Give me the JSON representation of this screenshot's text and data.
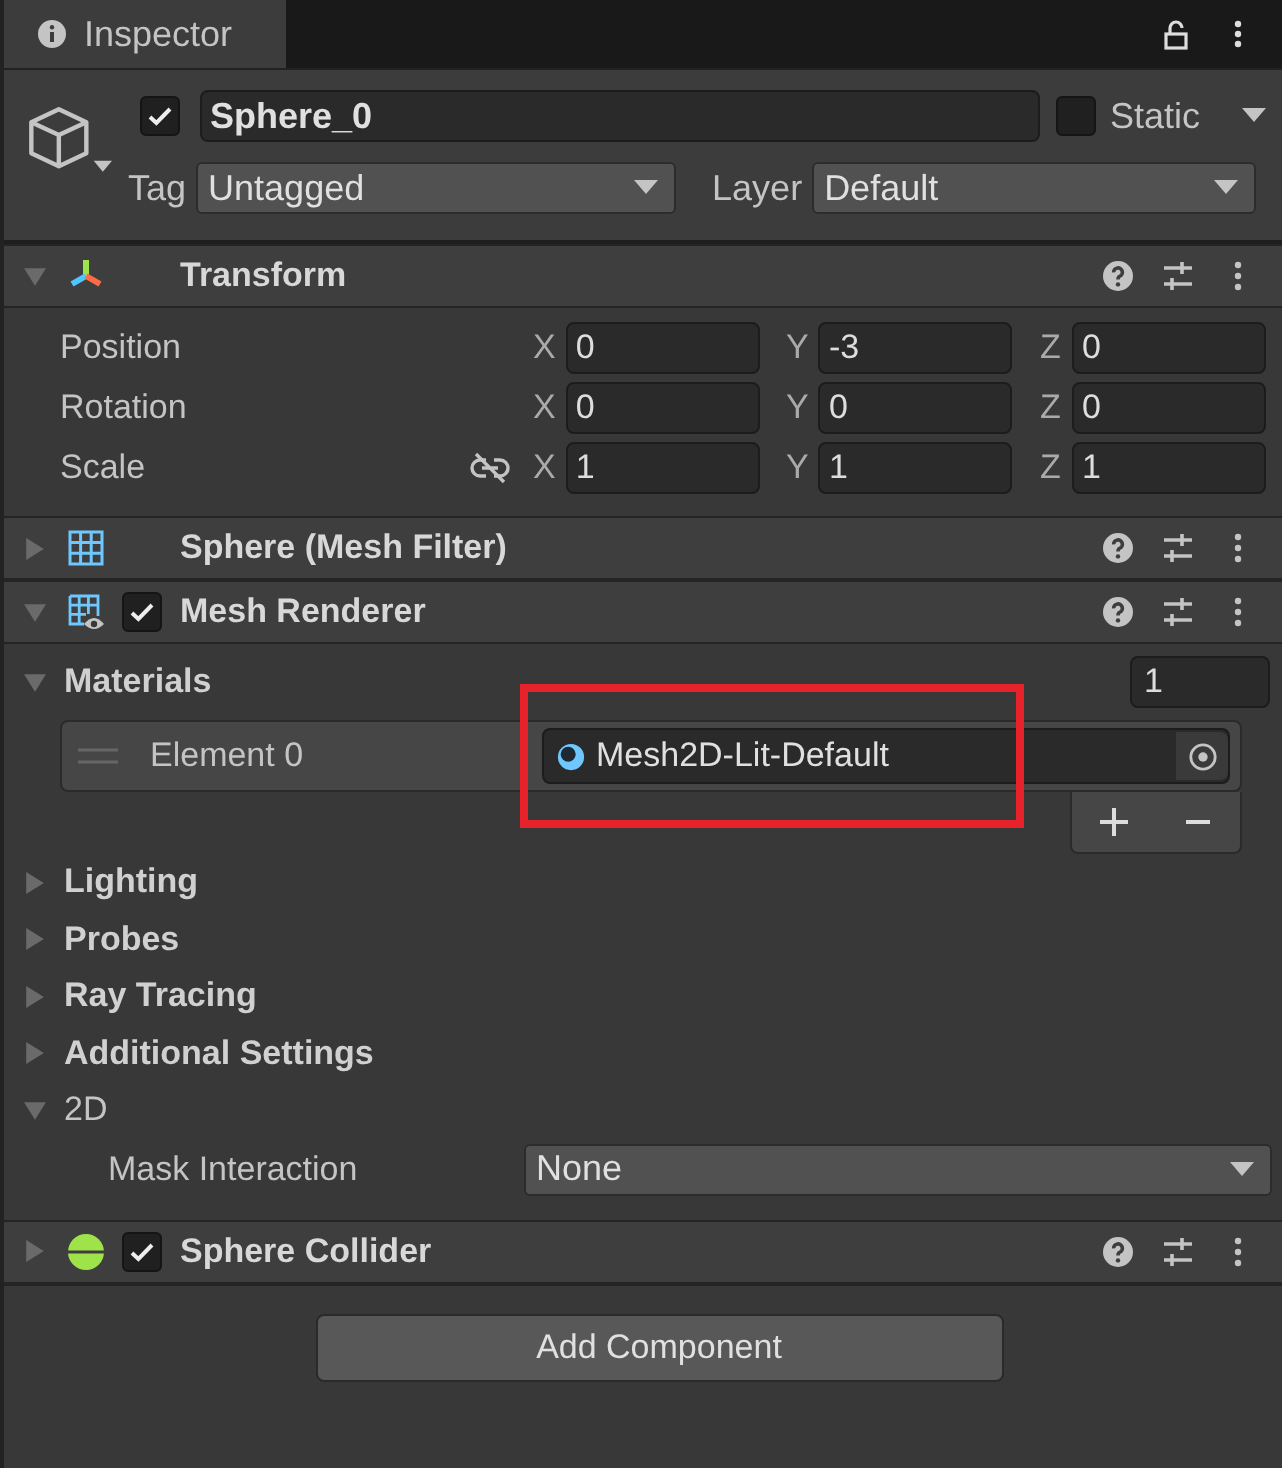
{
  "tab": {
    "title": "Inspector",
    "selected": true
  },
  "object": {
    "active": true,
    "name": "Sphere_0",
    "static": false,
    "static_label": "Static",
    "tag_label": "Tag",
    "tag": "Untagged",
    "layer_label": "Layer",
    "layer": "Default"
  },
  "components": [
    {
      "kind": "transform",
      "title": "Transform",
      "expanded": true,
      "rows": [
        {
          "label": "Position",
          "values": [
            {
              "axis": "X",
              "value": "0"
            },
            {
              "axis": "Y",
              "value": "-3"
            },
            {
              "axis": "Z",
              "value": "0"
            }
          ]
        },
        {
          "label": "Rotation",
          "values": [
            {
              "axis": "X",
              "value": "0"
            },
            {
              "axis": "Y",
              "value": "0"
            },
            {
              "axis": "Z",
              "value": "0"
            }
          ]
        },
        {
          "label": "Scale",
          "proportions_linked": false,
          "values": [
            {
              "axis": "X",
              "value": "1"
            },
            {
              "axis": "Y",
              "value": "1"
            },
            {
              "axis": "Z",
              "value": "1"
            }
          ]
        }
      ]
    },
    {
      "kind": "mesh_filter",
      "title": "Sphere (Mesh Filter)",
      "expanded": false
    },
    {
      "kind": "mesh_renderer",
      "title": "Mesh Renderer",
      "expanded": true,
      "enabled": true,
      "materials": {
        "label": "Materials",
        "expanded": true,
        "size": "1",
        "elements": [
          {
            "label": "Element 0",
            "value": "Mesh2D-Lit-Default",
            "highlighted": true
          }
        ]
      },
      "foldouts": [
        {
          "kind": "header",
          "label": "Lighting",
          "expanded": false
        },
        {
          "kind": "header",
          "label": "Probes",
          "expanded": false
        },
        {
          "kind": "header",
          "label": "Ray Tracing",
          "expanded": false
        },
        {
          "kind": "header",
          "label": "Additional Settings",
          "expanded": false
        },
        {
          "kind": "group",
          "label": "2D",
          "expanded": true,
          "properties": [
            {
              "label": "Mask Interaction",
              "value": "None"
            }
          ]
        }
      ]
    },
    {
      "kind": "sphere_collider",
      "title": "Sphere Collider",
      "expanded": false,
      "enabled": true
    }
  ],
  "add_component_button": "Add Component"
}
